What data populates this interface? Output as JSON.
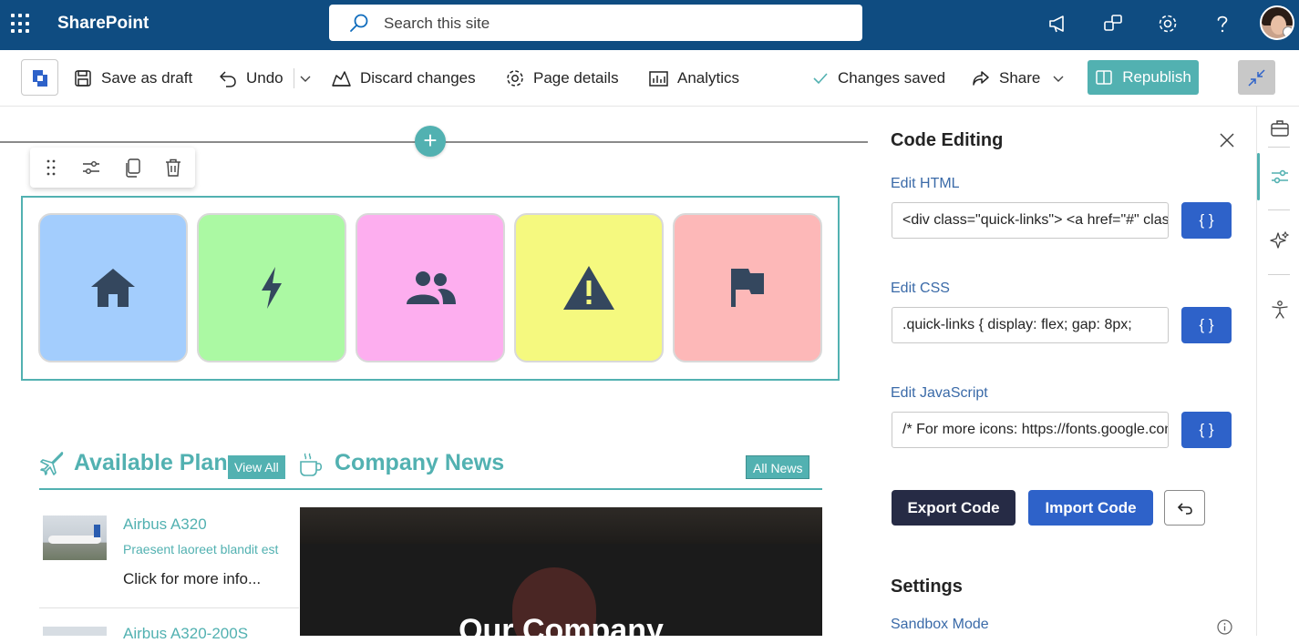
{
  "topbar": {
    "app_name": "SharePoint",
    "search_placeholder": "Search this site"
  },
  "commandbar": {
    "save_draft": "Save as draft",
    "undo": "Undo",
    "discard": "Discard changes",
    "page_details": "Page details",
    "analytics": "Analytics",
    "status": "Changes saved",
    "share": "Share",
    "republish": "Republish"
  },
  "quick_links": [
    {
      "icon": "home-icon",
      "color": "#a3cdfd"
    },
    {
      "icon": "lightning-icon",
      "color": "#abf9a3"
    },
    {
      "icon": "people-icon",
      "color": "#fdaeef"
    },
    {
      "icon": "warning-icon",
      "color": "#f5f97f"
    },
    {
      "icon": "flag-icon",
      "color": "#fdb8b8"
    }
  ],
  "planes": {
    "title": "Available Planes",
    "view_all": "View All",
    "items": [
      {
        "name": "Airbus A320",
        "subtitle": "Praesent laoreet blandit est",
        "more": "Click for more info..."
      },
      {
        "name": "Airbus A320-200S"
      }
    ]
  },
  "news": {
    "title": "Company News",
    "all_news": "All News",
    "hero_caption": "Our Company"
  },
  "panel": {
    "title": "Code Editing",
    "html_label": "Edit HTML",
    "html_value": "<div class=\"quick-links\">   <a href=\"#\" class=\"ql-item\">",
    "css_label": "Edit CSS",
    "css_value": ".quick-links {  display: flex;  gap: 8px;",
    "js_label": "Edit JavaScript",
    "js_value": "/* For more icons: https://fonts.google.com/icons */",
    "braces": "{ }",
    "export": "Export Code",
    "import": "Import Code",
    "settings": "Settings",
    "sandbox": "Sandbox Mode"
  },
  "colors": {
    "suite_bar": "#0f4c81",
    "accent": "#52b1b1",
    "primary_button": "#2e62c9",
    "export_button": "#262b45"
  }
}
